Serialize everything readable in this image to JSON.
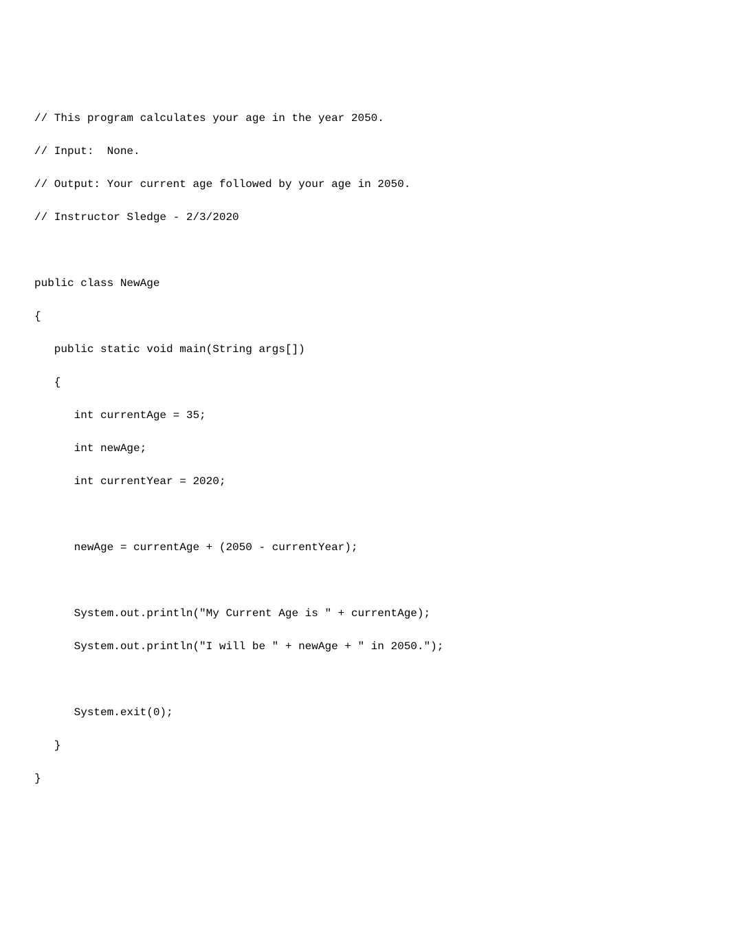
{
  "code": {
    "lines": [
      "// This program calculates your age in the year 2050.",
      "// Input:  None.",
      "// Output: Your current age followed by your age in 2050.",
      "// Instructor Sledge - 2/3/2020",
      "",
      "public class NewAge",
      "{",
      "   public static void main(String args[])",
      "   {",
      "      int currentAge = 35;",
      "      int newAge;",
      "      int currentYear = 2020;",
      "",
      "      newAge = currentAge + (2050 - currentYear);",
      "",
      "      System.out.println(\"My Current Age is \" + currentAge);",
      "      System.out.println(\"I will be \" + newAge + \" in 2050.\");",
      "",
      "      System.exit(0);",
      "   }",
      "}"
    ]
  }
}
